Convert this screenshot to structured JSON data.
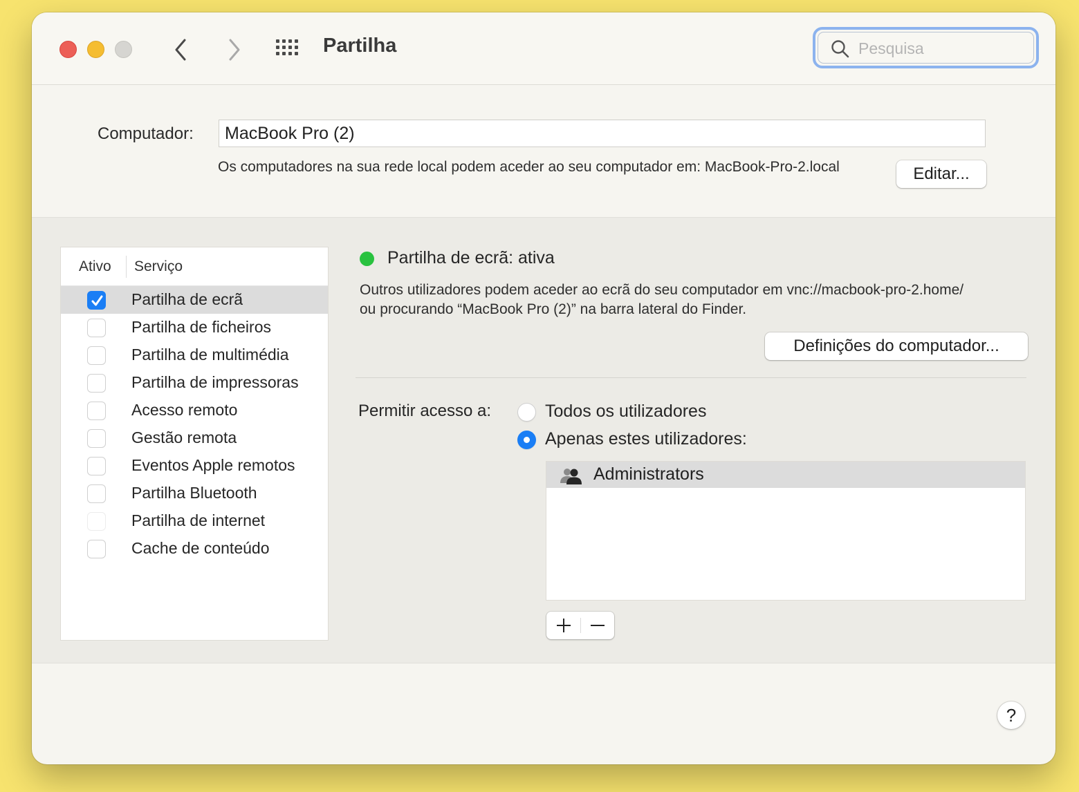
{
  "window": {
    "title": "Partilha",
    "search_placeholder": "Pesquisa"
  },
  "computer": {
    "label": "Computador:",
    "name": "MacBook Pro (2)",
    "description": "Os computadores na sua rede local podem aceder ao seu computador em: MacBook-Pro-2.local",
    "edit_button": "Editar..."
  },
  "services": {
    "col_active": "Ativo",
    "col_service": "Serviço",
    "items": [
      {
        "label": "Partilha de ecrã",
        "checked": true,
        "selected": true
      },
      {
        "label": "Partilha de ficheiros",
        "checked": false
      },
      {
        "label": "Partilha de multimédia",
        "checked": false
      },
      {
        "label": "Partilha de impressoras",
        "checked": false
      },
      {
        "label": "Acesso remoto",
        "checked": false
      },
      {
        "label": "Gestão remota",
        "checked": false
      },
      {
        "label": "Eventos Apple remotos",
        "checked": false
      },
      {
        "label": "Partilha Bluetooth",
        "checked": false
      },
      {
        "label": "Partilha de internet",
        "checked": false,
        "disabled": true
      },
      {
        "label": "Cache de conteúdo",
        "checked": false
      }
    ]
  },
  "detail": {
    "status": "Partilha de ecrã: ativa",
    "status_color": "#29c23f",
    "description": "Outros utilizadores podem aceder ao ecrã do seu computador em vnc://macbook-pro-2.home/ ou procurando “MacBook Pro (2)” na barra lateral do Finder.",
    "settings_button": "Definições do computador...",
    "access_label": "Permitir acesso a:",
    "option_all": "Todos os utilizadores",
    "option_some": "Apenas estes utilizadores:",
    "selected_option": "some",
    "users": [
      "Administrators"
    ],
    "add_icon": "plus-icon",
    "remove_icon": "minus-icon"
  },
  "help": {
    "label": "?"
  },
  "colors": {
    "accent": "#1a7ef5",
    "close": "#ec5f57",
    "minimize": "#f5bd31",
    "desktop": "#f7e36e"
  }
}
